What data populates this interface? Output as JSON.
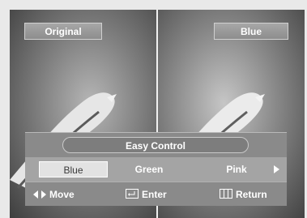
{
  "comparison": {
    "left_label": "Original",
    "right_label": "Blue"
  },
  "menu": {
    "title": "Easy Control",
    "options": [
      "Blue",
      "Green",
      "Pink"
    ],
    "selected": "Blue"
  },
  "footer": {
    "move_label": "Move",
    "enter_label": "Enter",
    "return_label": "Return"
  },
  "icons": {
    "move": "left-right-arrows-icon",
    "enter": "enter-icon",
    "return": "return-icon",
    "more": "arrow-right-icon"
  }
}
